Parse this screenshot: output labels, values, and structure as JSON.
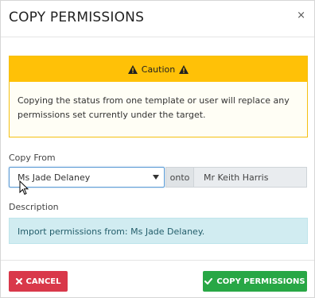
{
  "modal": {
    "title": "COPY PERMISSIONS",
    "close_icon": "×"
  },
  "caution": {
    "heading": "Caution",
    "message": "Copying the status from one template or user will replace any permissions set currently under the target.",
    "color": "#ffc107"
  },
  "copy_from": {
    "label": "Copy From",
    "selected": "Ms Jade Delaney",
    "onto_label": "onto",
    "target": "Mr Keith Harris"
  },
  "description": {
    "label": "Description",
    "text": "Import permissions from: Ms Jade Delaney."
  },
  "footer": {
    "cancel_label": "CANCEL",
    "copy_label": "COPY PERMISSIONS",
    "cancel_color": "#d9384a",
    "copy_color": "#28a745"
  }
}
